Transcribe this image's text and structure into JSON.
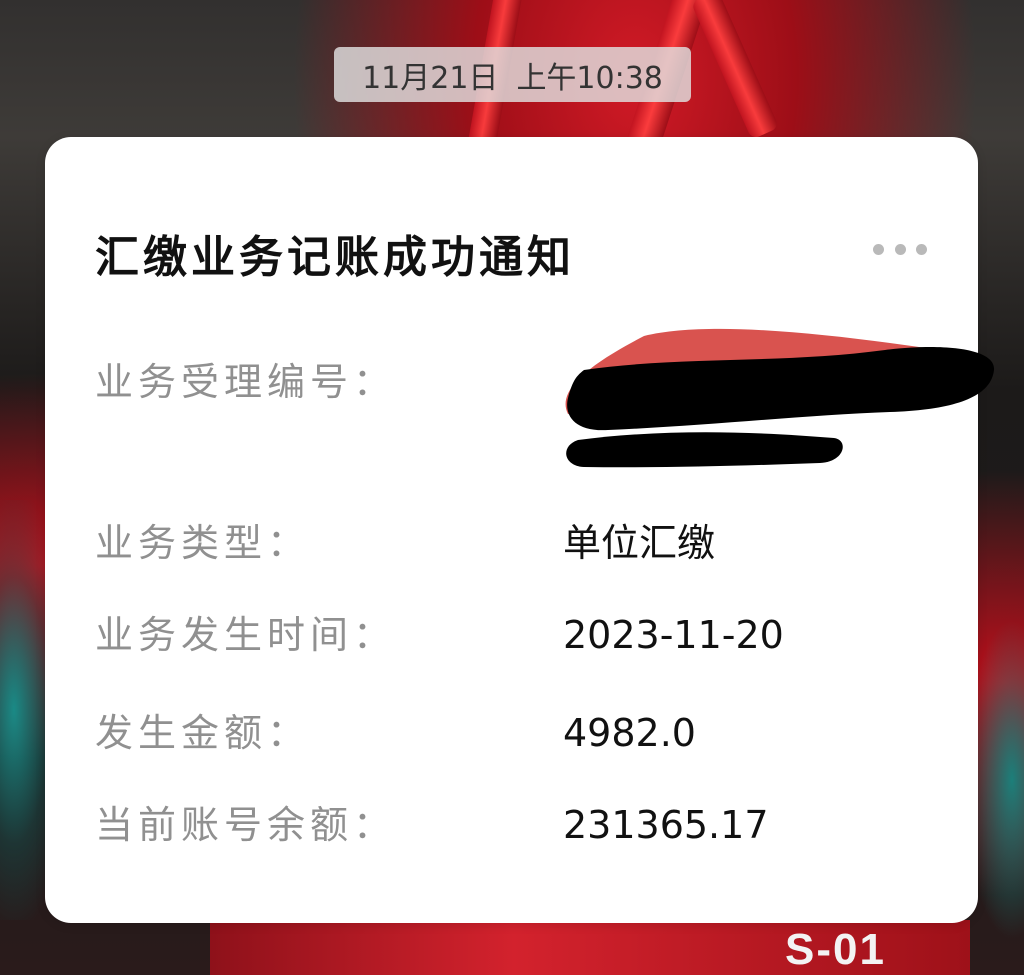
{
  "status_bar": {
    "date": "11月21日",
    "time": "上午10:38"
  },
  "notification": {
    "title": "汇缴业务记账成功通知",
    "menu_icon": "more-dots-icon",
    "fields": [
      {
        "label": "业务受理编号：",
        "value": ""
      },
      {
        "label": "业务类型：",
        "value": "单位汇缴"
      },
      {
        "label": "业务发生时间：",
        "value": "2023-11-20"
      },
      {
        "label": "发生金额：",
        "value": "4982.0"
      },
      {
        "label": "当前账号余额：",
        "value": "231365.17"
      }
    ]
  },
  "background": {
    "marking": "S-01"
  },
  "colors": {
    "card_background": "#ffffff",
    "label_text": "#909090",
    "value_text": "#111111",
    "redaction_black": "#000000",
    "redaction_red": "#d9534f"
  }
}
